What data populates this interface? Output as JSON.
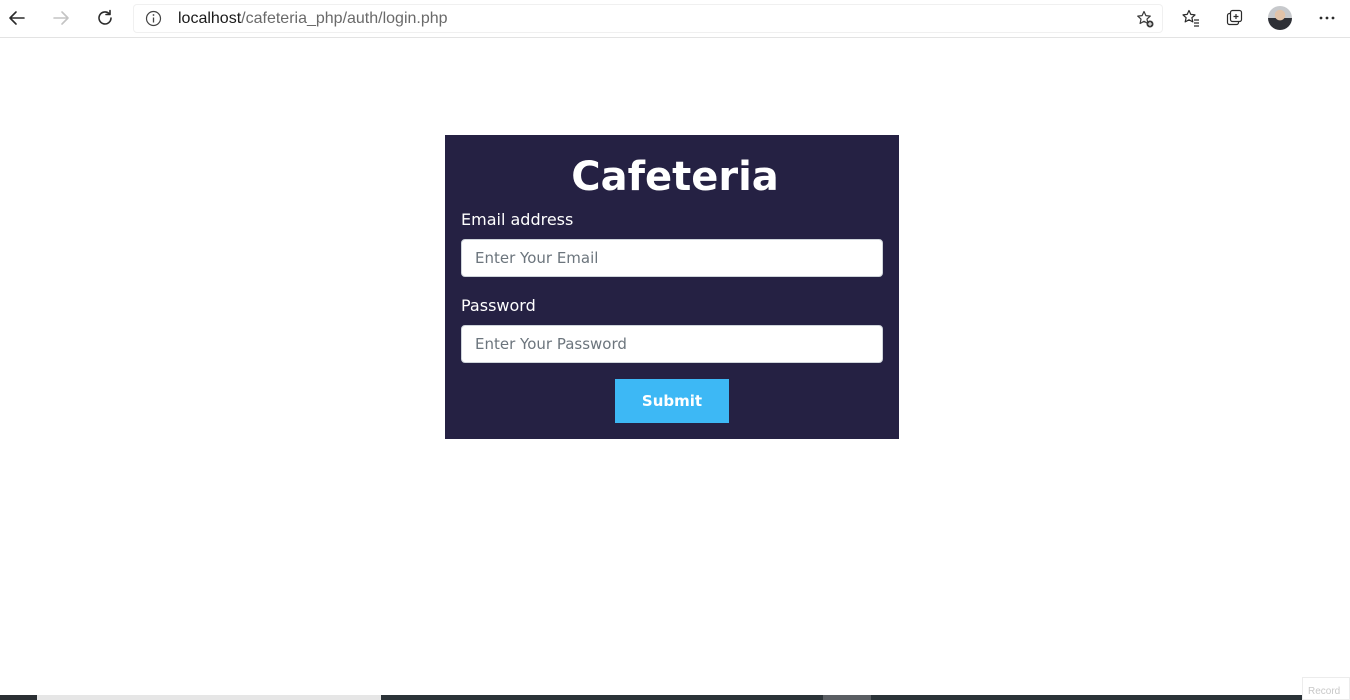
{
  "browser": {
    "url_host": "localhost",
    "url_path": "/cafeteria_php/auth/login.php",
    "icons": {
      "back": "back-arrow-icon",
      "forward": "forward-arrow-icon",
      "reload": "reload-icon",
      "site_info": "info-icon",
      "add_favorite": "add-favorite-star-icon",
      "favorites": "favorites-icon",
      "collections": "collections-icon",
      "profile": "avatar",
      "menu": "more-menu-icon"
    }
  },
  "login": {
    "title": "Cafeteria",
    "email_label": "Email address",
    "email_placeholder": "Enter Your Email",
    "email_value": "",
    "password_label": "Password",
    "password_placeholder": "Enter Your Password",
    "password_value": "",
    "submit_label": "Submit"
  },
  "overlay": {
    "record_label": "Record"
  },
  "colors": {
    "card_background": "#252143",
    "submit_button": "#3db8f5",
    "title_text": "#ffffff"
  }
}
